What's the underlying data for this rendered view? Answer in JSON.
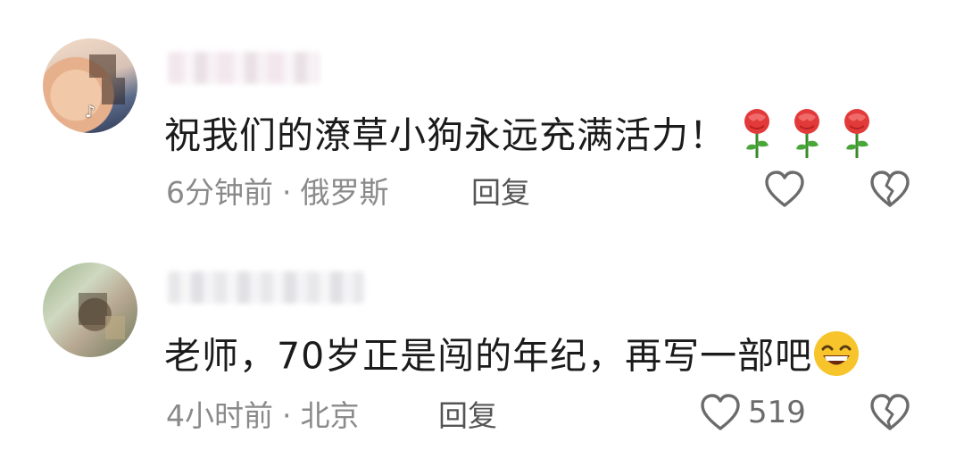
{
  "comments": [
    {
      "username": "",
      "text": "祝我们的潦草小狗永远充满活力！",
      "emoji": "rose-emoji",
      "time": "6分钟前",
      "separator": "·",
      "location": "俄罗斯",
      "reply_label": "回复",
      "like_count": ""
    },
    {
      "username": "",
      "text": "老师，70岁正是闯的年纪，再写一部吧",
      "emoji": "grinning-face-emoji",
      "time": "4小时前",
      "separator": "·",
      "location": "北京",
      "reply_label": "回复",
      "like_count": "519"
    }
  ],
  "icons": {
    "like": "heart-outline-icon",
    "dislike": "broken-heart-icon"
  },
  "colors": {
    "text": "#1b1b1b",
    "meta": "#8a8a8a",
    "icon": "#6b6b6b"
  }
}
